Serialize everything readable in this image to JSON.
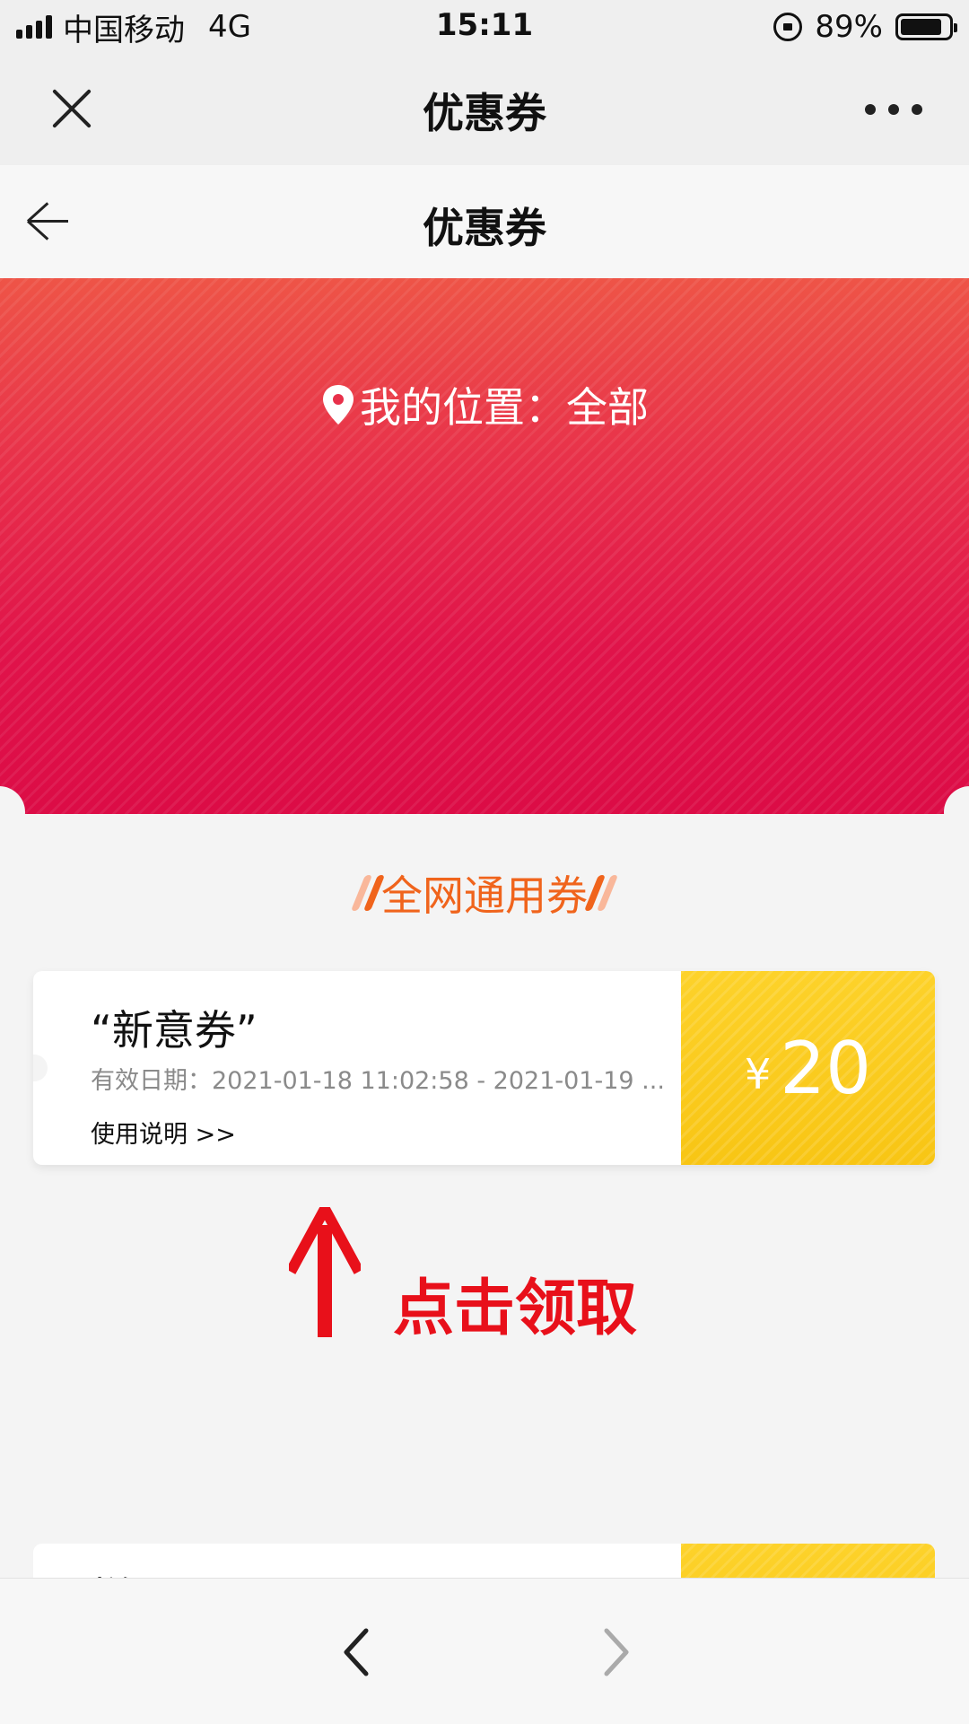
{
  "status_bar": {
    "carrier": "中国移动",
    "network": "4G",
    "time": "15:11",
    "battery": "89%"
  },
  "wechat_bar": {
    "title": "优惠券",
    "close_icon": "close-icon",
    "more_icon": "more-icon"
  },
  "page_header": {
    "title": "优惠券",
    "back_icon": "arrow-left-icon"
  },
  "banner": {
    "location_label": "我的位置：",
    "location_value": "全部",
    "colors": {
      "top": "#ee5447",
      "bottom": "#dc0c46"
    }
  },
  "section": {
    "title": "全网通用券",
    "color": "#f0641c"
  },
  "coupons": [
    {
      "name": "“新意券”",
      "validity": "有效日期：2021-01-18 11:02:58 - 2021-01-19 ...",
      "instructions": "使用说明 >>",
      "currency": "¥",
      "amount": "20",
      "accent": "#f8c514"
    },
    {
      "name": "样..."
    }
  ],
  "annotation": {
    "text": "点击领取",
    "color": "#e8101a"
  },
  "bottom_bar": {
    "prev_icon": "chevron-left-icon",
    "next_icon": "chevron-right-icon"
  }
}
